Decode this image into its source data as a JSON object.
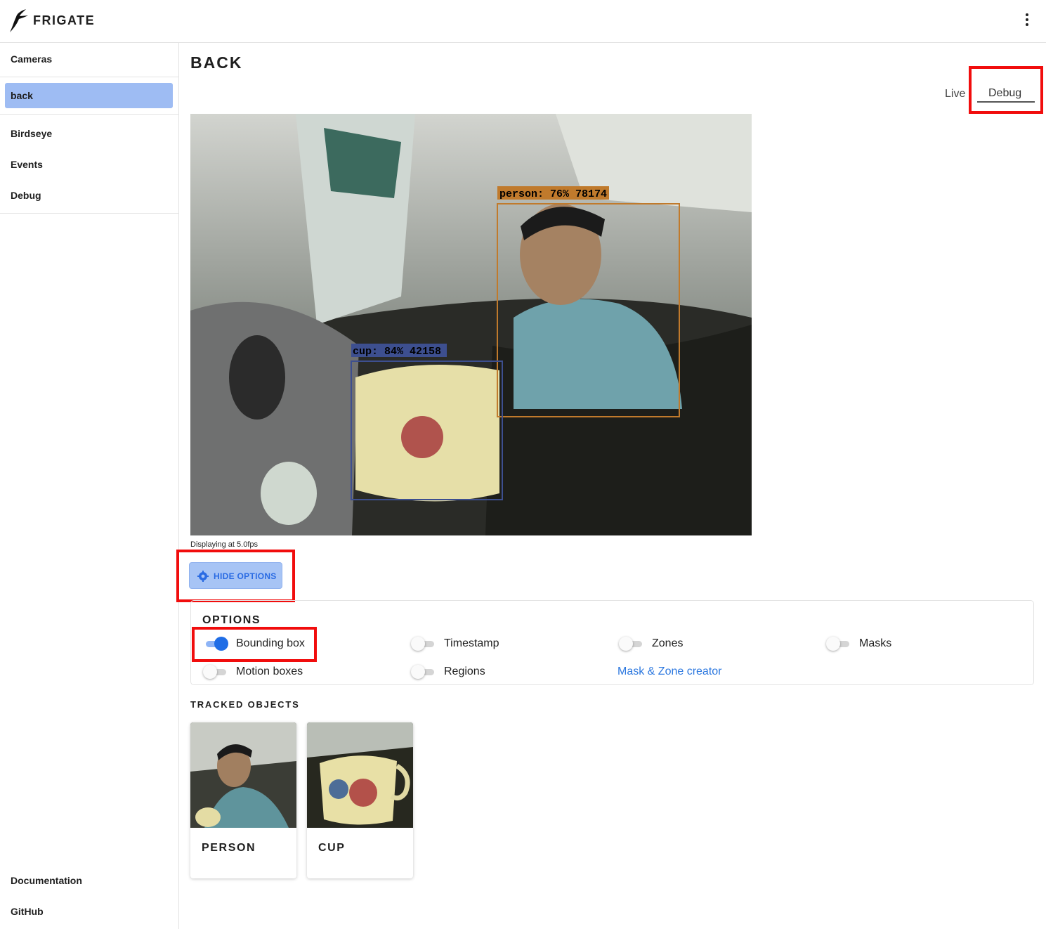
{
  "app": {
    "brand": "FRIGATE"
  },
  "sidebar": {
    "cameras_label": "Cameras",
    "active_camera": "back",
    "items": [
      "Birdseye",
      "Events",
      "Debug"
    ],
    "footer": [
      "Documentation",
      "GitHub"
    ]
  },
  "main": {
    "title": "BACK",
    "tabs": {
      "live": "Live",
      "debug": "Debug"
    },
    "feed": {
      "person_label": "person: 76% 78174",
      "cup_label": "cup: 84% 42158",
      "fps_text": "Displaying at 5.0fps"
    },
    "options_button": "HIDE OPTIONS",
    "options": {
      "title": "OPTIONS",
      "bounding_box": "Bounding box",
      "timestamp": "Timestamp",
      "zones": "Zones",
      "masks": "Masks",
      "motion_boxes": "Motion boxes",
      "regions": "Regions",
      "mask_zone_creator": "Mask & Zone creator"
    },
    "tracked": {
      "title": "TRACKED OBJECTS",
      "objects": [
        "PERSON",
        "CUP"
      ]
    }
  },
  "colors": {
    "accent": "#1f6de6",
    "sidebar_active": "#9ebcf3",
    "highlight": "#f10d0d",
    "person_box": "#c07a2c",
    "cup_box": "#3d4f8f"
  },
  "toggles_state": {
    "bounding_box": true,
    "timestamp": false,
    "zones": false,
    "masks": false,
    "motion_boxes": false,
    "regions": false
  }
}
